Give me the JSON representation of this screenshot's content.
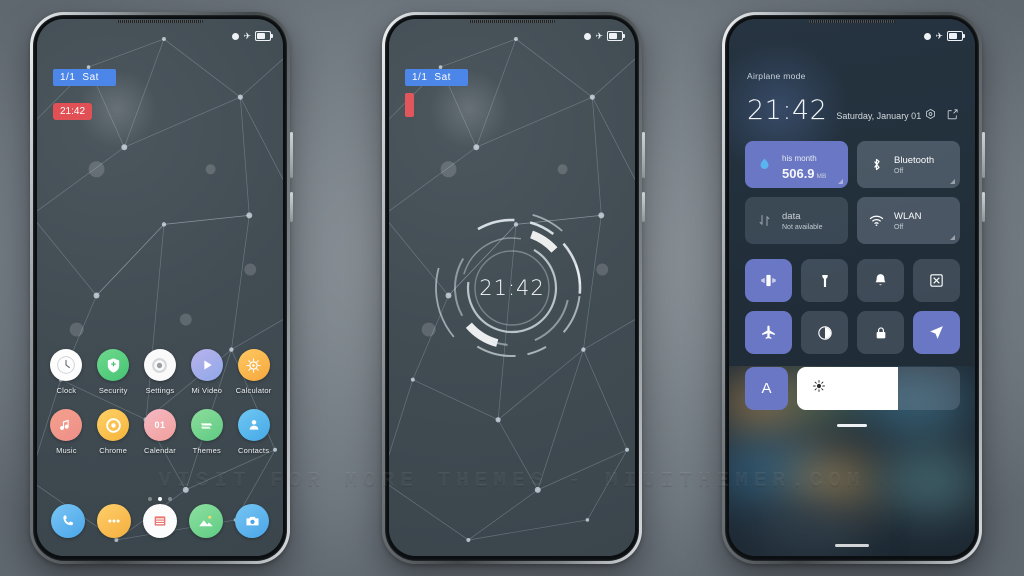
{
  "watermark": "VISIT FOR MORE THEMES - MIUITHEMER.COM",
  "status_bar": {
    "airplane_icon": "airplane-icon",
    "battery_icon": "battery-icon",
    "dot_icon": "dot-icon"
  },
  "phone1": {
    "name": "home-screen",
    "widgets": {
      "date_day": "1/1",
      "date_weekday": "Sat",
      "time": "21:42"
    },
    "apps_row1": [
      {
        "label": "Clock",
        "icon": "clock-icon"
      },
      {
        "label": "Security",
        "icon": "shield-icon"
      },
      {
        "label": "Settings",
        "icon": "gear-icon"
      },
      {
        "label": "Mi Video",
        "icon": "play-icon"
      },
      {
        "label": "Calculator",
        "icon": "calculator-icon"
      }
    ],
    "apps_row2": [
      {
        "label": "Music",
        "icon": "music-note-icon"
      },
      {
        "label": "Chrome",
        "icon": "chrome-icon"
      },
      {
        "label": "Calendar",
        "icon": "calendar-icon"
      },
      {
        "label": "Themes",
        "icon": "themes-icon"
      },
      {
        "label": "Contacts",
        "icon": "contacts-icon"
      }
    ],
    "calendar_day": "01",
    "page_dots": {
      "count": 3,
      "active": 1
    },
    "dock": [
      {
        "name": "phone",
        "icon": "phone-icon"
      },
      {
        "name": "messages",
        "icon": "messages-icon"
      },
      {
        "name": "browser",
        "icon": "browser-icon"
      },
      {
        "name": "gallery",
        "icon": "gallery-icon"
      },
      {
        "name": "camera",
        "icon": "camera-icon"
      }
    ]
  },
  "phone2": {
    "name": "lock-screen",
    "widgets": {
      "date_day": "1/1",
      "date_weekday": "Sat"
    },
    "clock": "21:42"
  },
  "phone3": {
    "name": "notification-shade",
    "airplane_label": "Airplane mode",
    "time": "21:42",
    "date": "Saturday, January 01",
    "header_icons": [
      {
        "name": "settings-gear-icon"
      },
      {
        "name": "edit-icon"
      }
    ],
    "tiles": [
      {
        "name": "data-usage-tile",
        "state": "active",
        "icon": "data-drop-icon",
        "top_label": "his month",
        "value": "506.9",
        "unit": "MB"
      },
      {
        "name": "bluetooth-tile",
        "state": "off",
        "icon": "bluetooth-icon",
        "title": "Bluetooth",
        "subtitle": "Off"
      },
      {
        "name": "mobile-data-tile",
        "state": "unavailable",
        "icon": "data-arrows-icon",
        "title": "data",
        "subtitle": "Not available"
      },
      {
        "name": "wlan-tile",
        "state": "off",
        "icon": "wifi-icon",
        "title": "WLAN",
        "subtitle": "Off"
      }
    ],
    "quick_toggles_row1": [
      {
        "name": "vibrate-toggle",
        "icon": "vibrate-icon",
        "on": true
      },
      {
        "name": "flashlight-toggle",
        "icon": "flashlight-icon",
        "on": false
      },
      {
        "name": "ringer-toggle",
        "icon": "bell-icon",
        "on": false
      },
      {
        "name": "screenshot-toggle",
        "icon": "screenshot-icon",
        "on": false
      }
    ],
    "quick_toggles_row2": [
      {
        "name": "airplane-toggle",
        "icon": "airplane-icon",
        "on": true
      },
      {
        "name": "dark-mode-toggle",
        "icon": "contrast-icon",
        "on": false
      },
      {
        "name": "lock-toggle",
        "icon": "lock-icon",
        "on": false
      },
      {
        "name": "location-toggle",
        "icon": "location-icon",
        "on": true
      }
    ],
    "brightness": {
      "auto_label": "A",
      "icon": "brightness-sun-icon",
      "level_percent": 62
    }
  },
  "colors": {
    "accent_blue": "#4b86e8",
    "accent_red": "#e05055",
    "tile_active": "#6a77c4",
    "screen_bg": "#3a454c",
    "shade_bg": "#22303c"
  }
}
